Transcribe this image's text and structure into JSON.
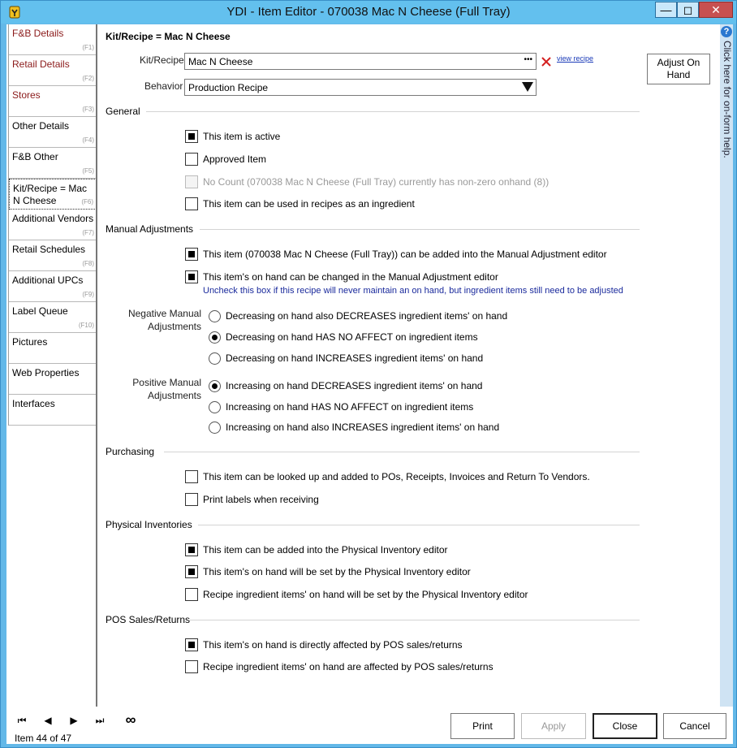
{
  "window": {
    "title": "YDI - Item Editor - 070038 Mac N Cheese (Full Tray)"
  },
  "sidebar": {
    "items": [
      {
        "label": "F&B Details",
        "key": "(F1)"
      },
      {
        "label": "Retail Details",
        "key": "(F2)"
      },
      {
        "label": "Stores",
        "key": "(F3)"
      },
      {
        "label": "Other Details",
        "key": "(F4)"
      },
      {
        "label": "F&B Other",
        "key": "(F5)"
      },
      {
        "label": "Kit/Recipe = Mac N Cheese",
        "key": "(F6)"
      },
      {
        "label": "Additional Vendors",
        "key": "(F7)"
      },
      {
        "label": "Retail Schedules",
        "key": "(F8)"
      },
      {
        "label": "Additional UPCs",
        "key": "(F9)"
      },
      {
        "label": "Label Queue",
        "key": "(F10)"
      },
      {
        "label": "Pictures",
        "key": ""
      },
      {
        "label": "Web Properties",
        "key": ""
      },
      {
        "label": "Interfaces",
        "key": ""
      }
    ]
  },
  "main": {
    "heading": "Kit/Recipe = Mac N Cheese",
    "kit_recipe_label": "Kit/Recipe",
    "kit_recipe_value": "Mac N Cheese",
    "ellipsis": "•••",
    "view_recipe": "view recipe",
    "behavior_label": "Behavior",
    "behavior_value": "Production Recipe",
    "adjust_button": "Adjust On Hand",
    "general": {
      "title": "General",
      "active": "This item is active",
      "approved": "Approved Item",
      "no_count": "No Count (070038 Mac N Cheese (Full Tray) currently has non-zero onhand (8))",
      "ingredient": "This item can be used in recipes as an ingredient"
    },
    "manual": {
      "title": "Manual Adjustments",
      "added": "This item (070038 Mac N Cheese (Full Tray)) can be added into the Manual Adjustment editor",
      "onhand": "This item's on hand can be changed in the Manual Adjustment editor",
      "note": "Uncheck this box if this recipe will never maintain an on hand, but ingredient items still need to be adjusted",
      "negative_label": "Negative Manual Adjustments",
      "negative_options": [
        "Decreasing on hand also DECREASES ingredient items' on hand",
        "Decreasing on hand HAS NO AFFECT on ingredient items",
        "Decreasing on hand INCREASES ingredient items' on hand"
      ],
      "positive_label": "Positive Manual Adjustments",
      "positive_options": [
        "Increasing on hand DECREASES ingredient items' on hand",
        "Increasing on hand HAS NO AFFECT on ingredient items",
        "Increasing on hand also INCREASES ingredient items' on hand"
      ]
    },
    "purchasing": {
      "title": "Purchasing",
      "lookup": "This item can be looked up and added to POs, Receipts, Invoices and Return To Vendors.",
      "labels": "Print labels when receiving"
    },
    "physical": {
      "title": "Physical Inventories",
      "added": "This item can be added into the Physical Inventory editor",
      "onhand": "This item's on hand will be set by the Physical Inventory editor",
      "ingredients": "Recipe ingredient items' on hand will be set by the Physical Inventory editor"
    },
    "pos": {
      "title": "POS Sales/Returns",
      "direct": "This item's on hand is directly affected by POS sales/returns",
      "ingredients": "Recipe ingredient items' on hand are affected by POS sales/returns"
    }
  },
  "help": {
    "text": "Click here for on-form help."
  },
  "footer": {
    "item_counter": "Item 44 of 47",
    "print": "Print",
    "apply": "Apply",
    "close": "Close",
    "cancel": "Cancel"
  }
}
